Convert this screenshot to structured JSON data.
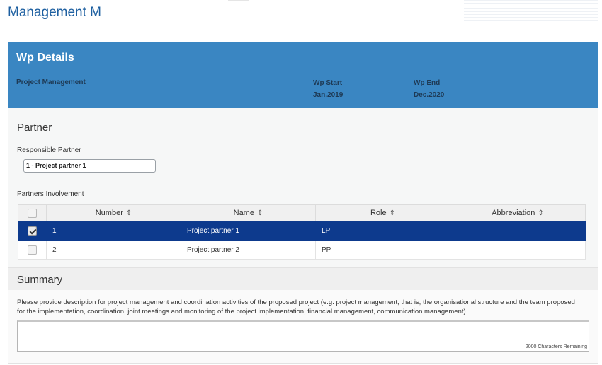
{
  "page": {
    "title": "Management M"
  },
  "wp": {
    "title": "Wp Details",
    "name": "Project Management",
    "start_label": "Wp Start",
    "start_value": "Jan.2019",
    "end_label": "Wp End",
    "end_value": "Dec.2020"
  },
  "partner": {
    "section_title": "Partner",
    "responsible_label": "Responsible Partner",
    "responsible_value": "1 - Project partner 1",
    "involvement_label": "Partners Involvement",
    "columns": [
      "Number",
      "Name",
      "Role",
      "Abbreviation"
    ],
    "rows": [
      {
        "number": "1",
        "name": "Project partner 1",
        "role": "LP",
        "abbreviation": "",
        "checked": true
      },
      {
        "number": "2",
        "name": "Project partner 2",
        "role": "PP",
        "abbreviation": "",
        "checked": false
      }
    ]
  },
  "summary": {
    "title": "Summary",
    "description": "Please provide description for project management and coordination activities of the proposed project (e.g. project management, that is, the organisational structure and the team proposed for the implementation, coordination, joint meetings and monitoring of the project implementation, financial management, communication management).",
    "text_value": "",
    "chars_remaining": "2000 Characters Remaining"
  },
  "icons": {
    "sort": "sort-icon",
    "check": "checkmark-icon"
  },
  "colors": {
    "header_bg": "#3a86c2",
    "selected_row": "#0d3a8d",
    "title_text": "#1d5fa0"
  }
}
